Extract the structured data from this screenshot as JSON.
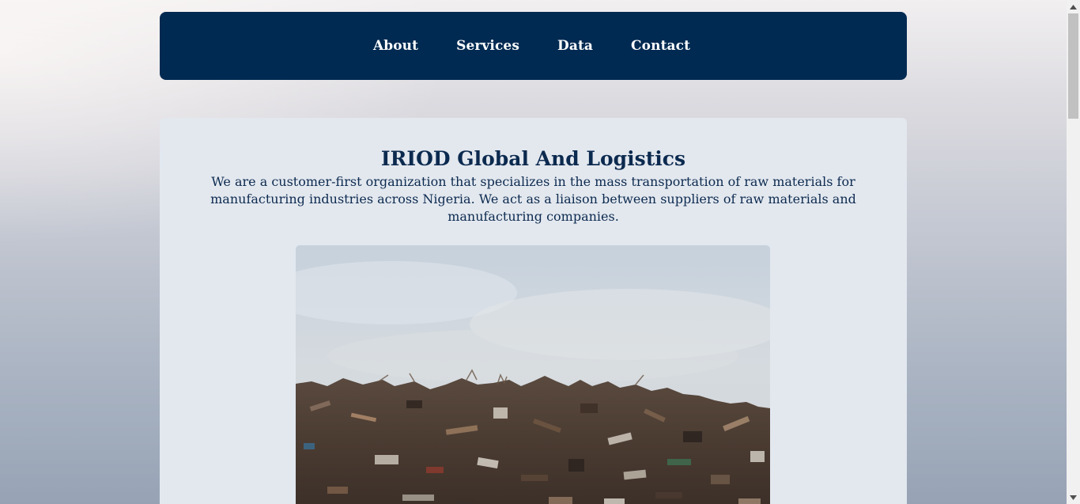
{
  "nav": {
    "items": [
      {
        "label": "About"
      },
      {
        "label": "Services"
      },
      {
        "label": "Data"
      },
      {
        "label": "Contact"
      }
    ]
  },
  "hero": {
    "title": "IRIOD Global And Logistics",
    "description": "We are a customer-first organization that specializes in the mass transportation of raw materials for manufacturing industries across Nigeria. We act as a liaison between suppliers of raw materials and manufacturing companies.",
    "image": {
      "icon": "scrap-metal-pile-photo"
    }
  },
  "colors": {
    "navbar": "#002a52",
    "accent_text": "#0c2a4f",
    "card_bg": "#e3e8ef"
  }
}
